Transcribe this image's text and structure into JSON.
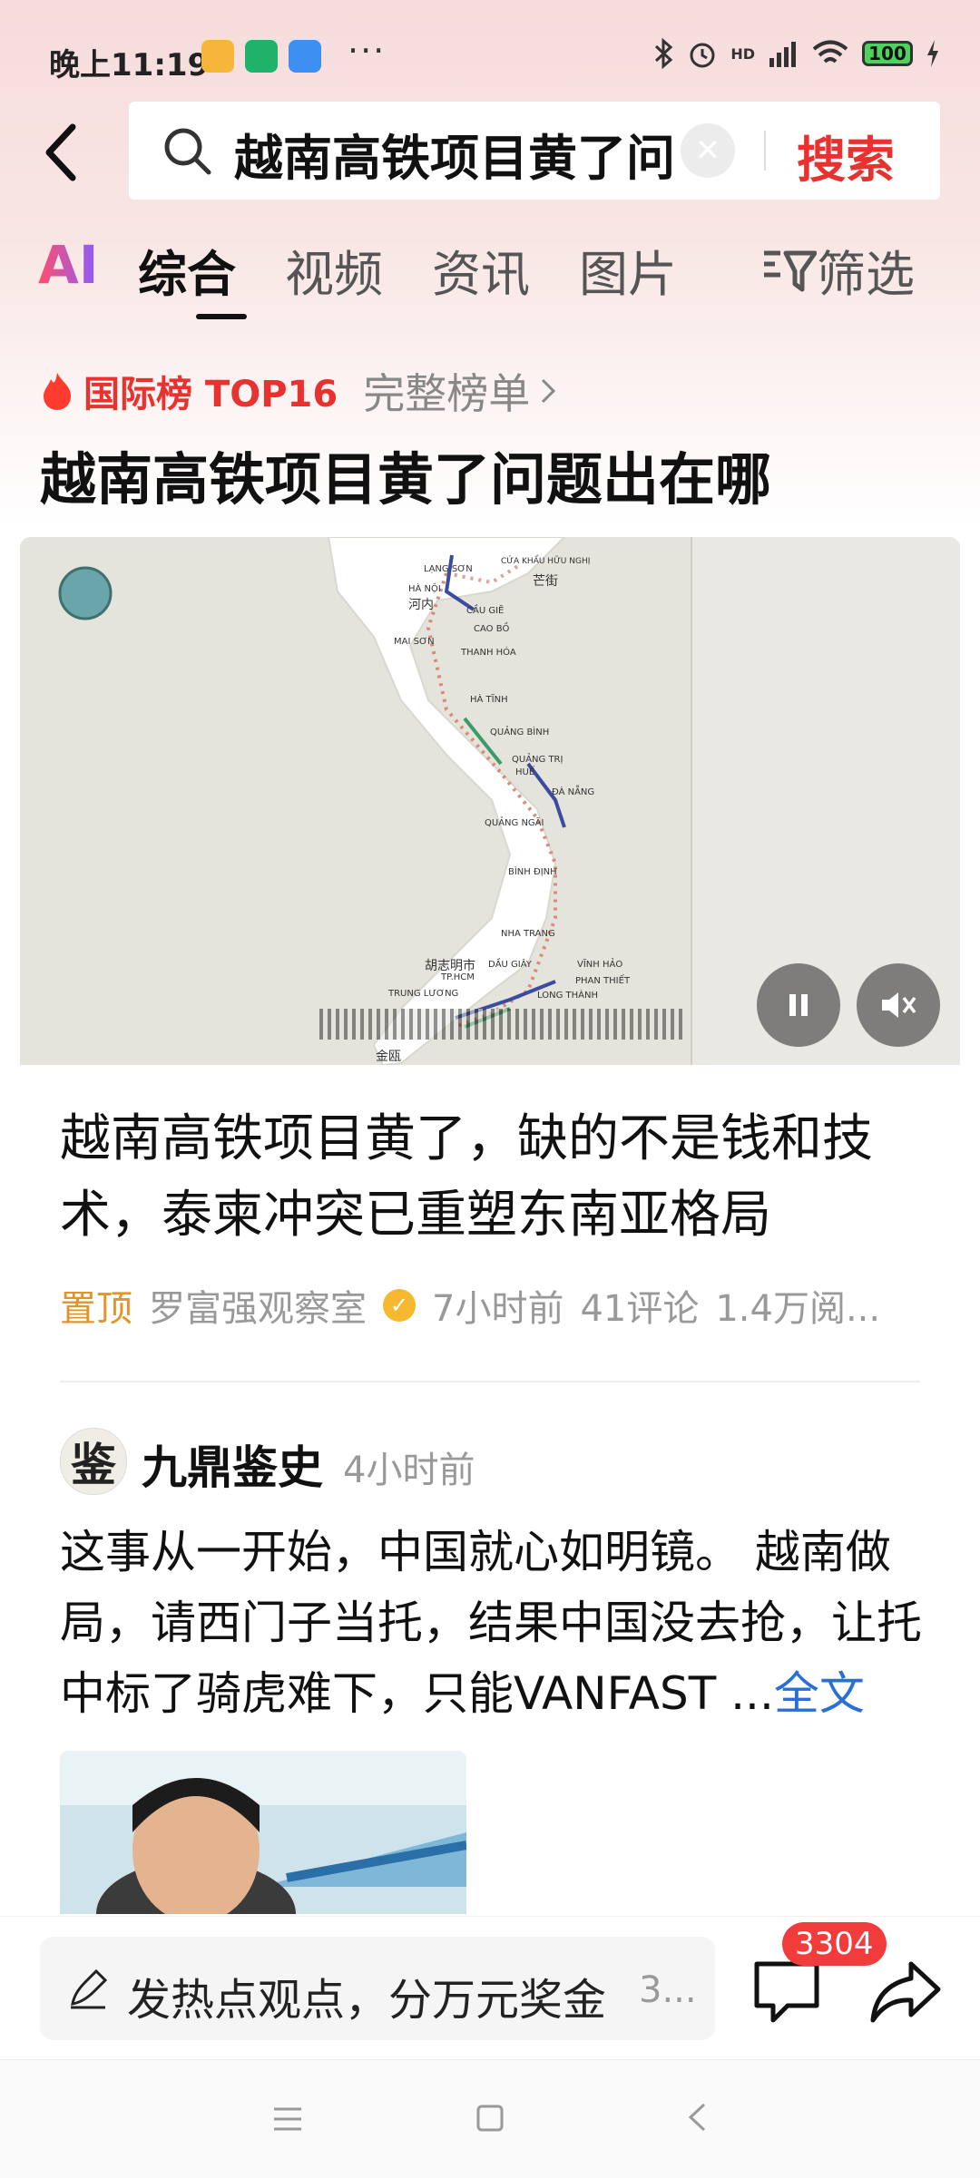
{
  "status_bar": {
    "time": "晚上11:19",
    "dots": "···",
    "network": "HD",
    "battery": "100"
  },
  "search": {
    "query": "越南高铁项目黄了问",
    "button": "搜索"
  },
  "tabs": [
    {
      "label": "AI"
    },
    {
      "label": "综合"
    },
    {
      "label": "视频"
    },
    {
      "label": "资讯"
    },
    {
      "label": "图片"
    },
    {
      "label": "筛选"
    }
  ],
  "rank": {
    "label": "国际榜 TOP16",
    "full_list": "完整榜单"
  },
  "headline": "越南高铁项目黄了问题出在哪",
  "map": {
    "places": [
      "LẠNG SƠN",
      "CỬA KHẨU HỮU NGHỊ",
      "HÀ NỘI",
      "河内",
      "芒街",
      "CẦU GIẼ",
      "CAO BỒ",
      "MAI SƠN",
      "THANH HÓA",
      "HÀ TĨNH",
      "QUẢNG BÌNH",
      "QUẢNG TRỊ",
      "HUẾ",
      "ĐÀ NẴNG",
      "QUẢNG NGÃI",
      "BÌNH ĐỊNH",
      "NHA TRANG",
      "胡志明市",
      "TP.HCM",
      "DẦU GIÂY",
      "VĨNH HẢO",
      "PHAN THIẾT",
      "LONG THÀNH",
      "TRUNG LƯƠNG",
      "金瓯"
    ]
  },
  "article": {
    "title": "越南高铁项目黄了，缺的不是钱和技术，泰柬冲突已重塑东南亚格局",
    "pin": "置顶",
    "source": "罗富强观察室",
    "time": "7小时前",
    "comments": "41评论",
    "reads": "1.4万阅..."
  },
  "post": {
    "avatar_char": "鉴",
    "author": "九鼎鉴史",
    "time": "4小时前",
    "text": "这事从一开始，中国就心如明镜。 越南做局，请西门子当托，结果中国没去抢，让托中标了骑虎难下，只能VANFAST  ...",
    "more": "全文"
  },
  "bottom_bar": {
    "placeholder": "发热点观点，分万元奖金",
    "placeholder_suffix": "3...",
    "comment_count": "3304"
  },
  "colors": {
    "accent_red": "#e8322f",
    "link_blue": "#2a6fd6",
    "pin_orange": "#e0952b"
  }
}
